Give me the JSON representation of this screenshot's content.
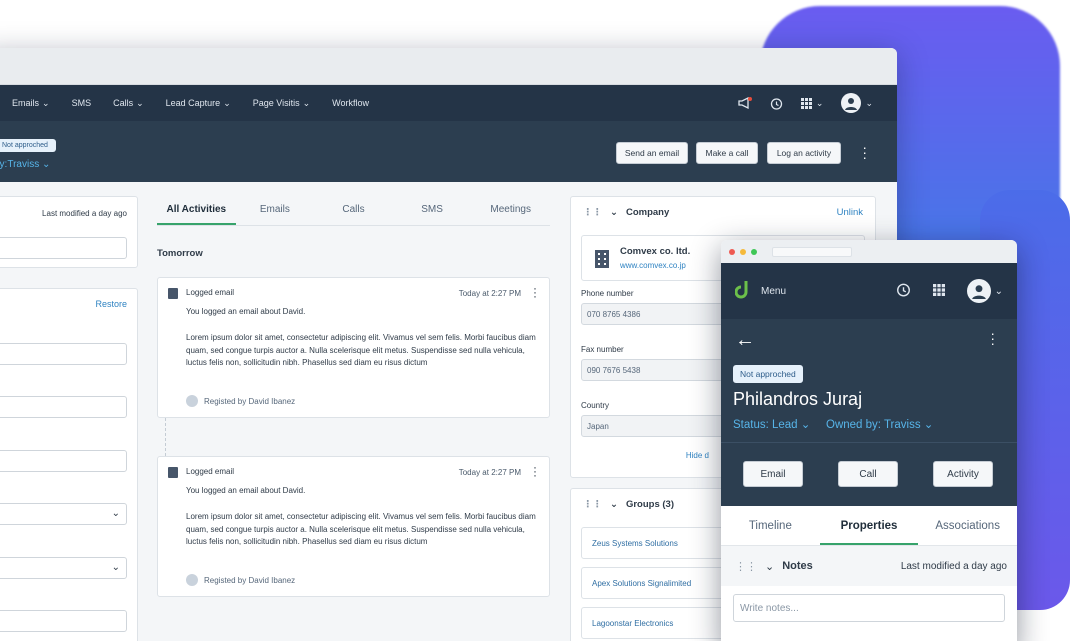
{
  "nav": {
    "items": [
      "Emails",
      "SMS",
      "Calls",
      "Lead Capture",
      "Page Visitis",
      "Workflow"
    ]
  },
  "header": {
    "status_badge": "Not approched",
    "owned_by": "by:Traviss",
    "buttons": {
      "send_email": "Send an email",
      "make_call": "Make a call",
      "log_activity": "Log an activity"
    }
  },
  "left": {
    "last_modified": "Last modified a day ago",
    "restore": "Restore"
  },
  "activities": {
    "tabs": [
      "All Activities",
      "Emails",
      "Calls",
      "SMS",
      "Meetings"
    ],
    "day": "Tomorrow",
    "items": [
      {
        "title": "Logged email",
        "time": "Today at 2:27 PM",
        "summary": "You logged an email about David.",
        "body": "Lorem ipsum dolor sit amet, consectetur adipiscing elit. Vivamus vel sem felis. Morbi faucibus diam quam, sed congue turpis auctor a. Nulla scelerisque elit metus. Suspendisse sed nulla vehicula, luctus felis non, sollicitudin nibh. Phasellus sed diam eu risus dictum",
        "registered": "Registed by David Ibanez"
      },
      {
        "title": "Logged email",
        "time": "Today at 2:27 PM",
        "summary": "You logged an email about David.",
        "body": "Lorem ipsum dolor sit amet, consectetur adipiscing elit. Vivamus vel sem felis. Morbi faucibus diam quam, sed congue turpis auctor a. Nulla scelerisque elit metus. Suspendisse sed nulla vehicula, luctus felis non, sollicitudin nibh. Phasellus sed diam eu risus dictum",
        "registered": "Registed by David Ibanez"
      }
    ]
  },
  "company": {
    "title": "Company",
    "unlink": "Unlink",
    "name": "Comvex co. ltd.",
    "url": "www.comvex.co.jp",
    "phone_label": "Phone number",
    "phone": "070 8765 4386",
    "fax_label": "Fax number",
    "fax": "090 7676 5438",
    "country_label": "Country",
    "country": "Japan",
    "hide": "Hide d"
  },
  "groups": {
    "title": "Groups (3)",
    "items": [
      "Zeus Systems Solutions",
      "Apex Solutions Signalimited",
      "Lagoonstar Electronics"
    ]
  },
  "mobile": {
    "menu": "Menu",
    "status_badge": "Not approched",
    "name": "Philandros Juraj",
    "status": "Status: Lead",
    "owned": "Owned by: Traviss",
    "buttons": [
      "Email",
      "Call",
      "Activity"
    ],
    "tabs": [
      "Timeline",
      "Properties",
      "Associations"
    ],
    "notes_title": "Notes",
    "notes_modified": "Last modified a day ago",
    "notes_placeholder": "Write notes..."
  },
  "colors": {
    "nav_bg": "#243447",
    "header_bg": "#2c3e50",
    "accent_green": "#37a36b",
    "link_blue": "#2f83c2"
  }
}
